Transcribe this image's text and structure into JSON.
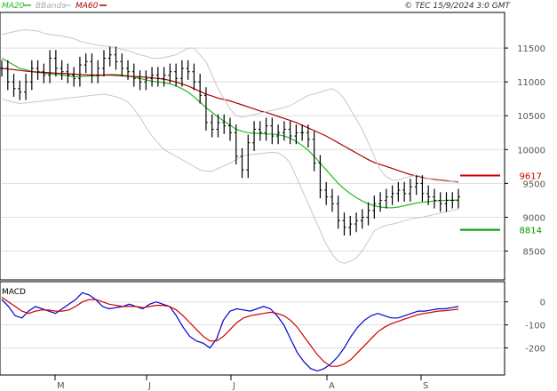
{
  "header": {
    "ma20_label": "MA20",
    "bbands_label": "BBands",
    "ma60_label": "MA60",
    "copyright": "© TEC 15/9/2024 3:0 GMT"
  },
  "colors": {
    "ma20": "#22bb22",
    "ma60": "#aa0000",
    "bbands": "#c8c8c8",
    "price": "#000000",
    "macd": "#0000cc",
    "signal": "#cc0000",
    "grid": "#dddddd",
    "axis": "#000000"
  },
  "markers": [
    {
      "value": 9617,
      "label": "9617",
      "color": "#cc0000"
    },
    {
      "value": 8814,
      "label": "8814",
      "color": "#009900"
    }
  ],
  "macd_label": "MACD",
  "chart_data": [
    {
      "type": "line",
      "title": "",
      "x_ticks": [
        "M",
        "J",
        "J",
        "A",
        "S"
      ],
      "y_ticks": [
        8500,
        9000,
        9500,
        10000,
        10500,
        11000,
        11500
      ],
      "ylim": [
        8100,
        12000
      ],
      "grid": true,
      "series": [
        {
          "name": "Price",
          "values": [
            11200,
            11000,
            10900,
            10850,
            11000,
            11200,
            11150,
            11100,
            11350,
            11200,
            11150,
            11100,
            11050,
            11250,
            11300,
            11100,
            11200,
            11350,
            11400,
            11300,
            11200,
            11150,
            11050,
            11000,
            11050,
            11100,
            11050,
            11100,
            11150,
            11050,
            11200,
            11150,
            11000,
            10800,
            10400,
            10300,
            10400,
            10350,
            10250,
            9900,
            9700,
            10100,
            10300,
            10250,
            10350,
            10200,
            10250,
            10300,
            10200,
            10250,
            10250,
            10150,
            9800,
            9400,
            9300,
            9200,
            8950,
            8850,
            8900,
            8950,
            9000,
            9100,
            9200,
            9250,
            9300,
            9350,
            9400,
            9350,
            9450,
            9500,
            9350,
            9300,
            9250,
            9200,
            9250,
            9250,
            9300
          ]
        },
        {
          "name": "MA20",
          "values": [
            11350,
            11300,
            11250,
            11200,
            11180,
            11150,
            11140,
            11130,
            11120,
            11110,
            11100,
            11090,
            11080,
            11080,
            11085,
            11090,
            11090,
            11100,
            11110,
            11110,
            11100,
            11090,
            11070,
            11050,
            11030,
            11010,
            11000,
            10990,
            10970,
            10940,
            10900,
            10850,
            10780,
            10700,
            10620,
            10550,
            10480,
            10420,
            10360,
            10300,
            10270,
            10250,
            10240,
            10240,
            10230,
            10230,
            10220,
            10200,
            10170,
            10120,
            10060,
            9990,
            9900,
            9800,
            9700,
            9600,
            9500,
            9420,
            9350,
            9290,
            9240,
            9200,
            9170,
            9150,
            9140,
            9140,
            9150,
            9170,
            9190,
            9210,
            9220,
            9230,
            9240,
            9245,
            9250,
            9250,
            9255
          ]
        },
        {
          "name": "MA60",
          "values": [
            11200,
            11190,
            11180,
            11170,
            11160,
            11150,
            11145,
            11140,
            11135,
            11130,
            11125,
            11120,
            11115,
            11110,
            11105,
            11100,
            11100,
            11100,
            11100,
            11095,
            11090,
            11085,
            11080,
            11075,
            11070,
            11060,
            11050,
            11040,
            11020,
            11000,
            10970,
            10940,
            10900,
            10860,
            10820,
            10790,
            10760,
            10740,
            10720,
            10690,
            10660,
            10630,
            10600,
            10570,
            10550,
            10520,
            10490,
            10460,
            10430,
            10400,
            10360,
            10320,
            10280,
            10240,
            10200,
            10150,
            10100,
            10050,
            10000,
            9950,
            9900,
            9850,
            9810,
            9780,
            9750,
            9720,
            9690,
            9660,
            9630,
            9610,
            9590,
            9570,
            9560,
            9550,
            9540,
            9530,
            9520
          ]
        },
        {
          "name": "BBands upper",
          "values": [
            11700,
            11720,
            11740,
            11760,
            11770,
            11760,
            11750,
            11720,
            11700,
            11690,
            11680,
            11660,
            11640,
            11600,
            11580,
            11560,
            11540,
            11530,
            11520,
            11510,
            11480,
            11460,
            11430,
            11400,
            11380,
            11350,
            11350,
            11360,
            11380,
            11400,
            11450,
            11500,
            11500,
            11400,
            11300,
            11100,
            10900,
            10750,
            10600,
            10500,
            10480,
            10500,
            10520,
            10540,
            10560,
            10580,
            10600,
            10620,
            10650,
            10700,
            10750,
            10800,
            10820,
            10850,
            10880,
            10900,
            10850,
            10750,
            10600,
            10450,
            10300,
            10100,
            9900,
            9700,
            9600,
            9550,
            9550,
            9580,
            9600,
            9620,
            9600,
            9570,
            9550,
            9540,
            9530,
            9530,
            9530
          ]
        },
        {
          "name": "BBands lower",
          "values": [
            10750,
            10720,
            10700,
            10680,
            10690,
            10700,
            10710,
            10720,
            10730,
            10740,
            10750,
            10760,
            10770,
            10780,
            10790,
            10800,
            10810,
            10820,
            10800,
            10780,
            10750,
            10700,
            10600,
            10480,
            10330,
            10200,
            10100,
            10000,
            9950,
            9900,
            9850,
            9800,
            9750,
            9700,
            9680,
            9680,
            9720,
            9760,
            9800,
            9850,
            9900,
            9920,
            9930,
            9940,
            9950,
            9960,
            9950,
            9900,
            9800,
            9600,
            9400,
            9200,
            9000,
            8800,
            8600,
            8450,
            8350,
            8320,
            8350,
            8400,
            8500,
            8650,
            8800,
            8850,
            8880,
            8900,
            8920,
            8950,
            8970,
            8990,
            9000,
            9020,
            9040,
            9060,
            9080,
            9100,
            9120
          ]
        }
      ]
    },
    {
      "type": "line",
      "title": "MACD",
      "x_ticks": [
        "M",
        "J",
        "J",
        "A",
        "S"
      ],
      "y_ticks": [
        0,
        -100,
        -200
      ],
      "ylim": [
        -310,
        80
      ],
      "grid": true,
      "series": [
        {
          "name": "MACD",
          "values": [
            10,
            -20,
            -60,
            -70,
            -40,
            -20,
            -30,
            -40,
            -50,
            -30,
            -10,
            10,
            40,
            30,
            10,
            -20,
            -30,
            -25,
            -20,
            -10,
            -20,
            -30,
            -10,
            0,
            -10,
            -20,
            -60,
            -110,
            -150,
            -170,
            -180,
            -200,
            -160,
            -80,
            -40,
            -30,
            -35,
            -40,
            -30,
            -20,
            -30,
            -60,
            -100,
            -160,
            -220,
            -260,
            -290,
            -300,
            -290,
            -270,
            -240,
            -200,
            -150,
            -110,
            -80,
            -60,
            -50,
            -60,
            -70,
            -70,
            -60,
            -50,
            -40,
            -40,
            -35,
            -30,
            -30,
            -25,
            -20
          ]
        },
        {
          "name": "Signal",
          "values": [
            20,
            0,
            -20,
            -40,
            -50,
            -40,
            -35,
            -35,
            -40,
            -40,
            -35,
            -20,
            0,
            10,
            10,
            0,
            -10,
            -15,
            -20,
            -20,
            -20,
            -25,
            -20,
            -15,
            -15,
            -20,
            -35,
            -60,
            -90,
            -120,
            -150,
            -170,
            -170,
            -150,
            -120,
            -90,
            -70,
            -60,
            -55,
            -50,
            -45,
            -50,
            -60,
            -80,
            -110,
            -150,
            -190,
            -230,
            -260,
            -280,
            -280,
            -270,
            -250,
            -220,
            -190,
            -160,
            -130,
            -110,
            -95,
            -85,
            -75,
            -65,
            -55,
            -50,
            -45,
            -40,
            -38,
            -35,
            -32
          ]
        }
      ]
    }
  ]
}
